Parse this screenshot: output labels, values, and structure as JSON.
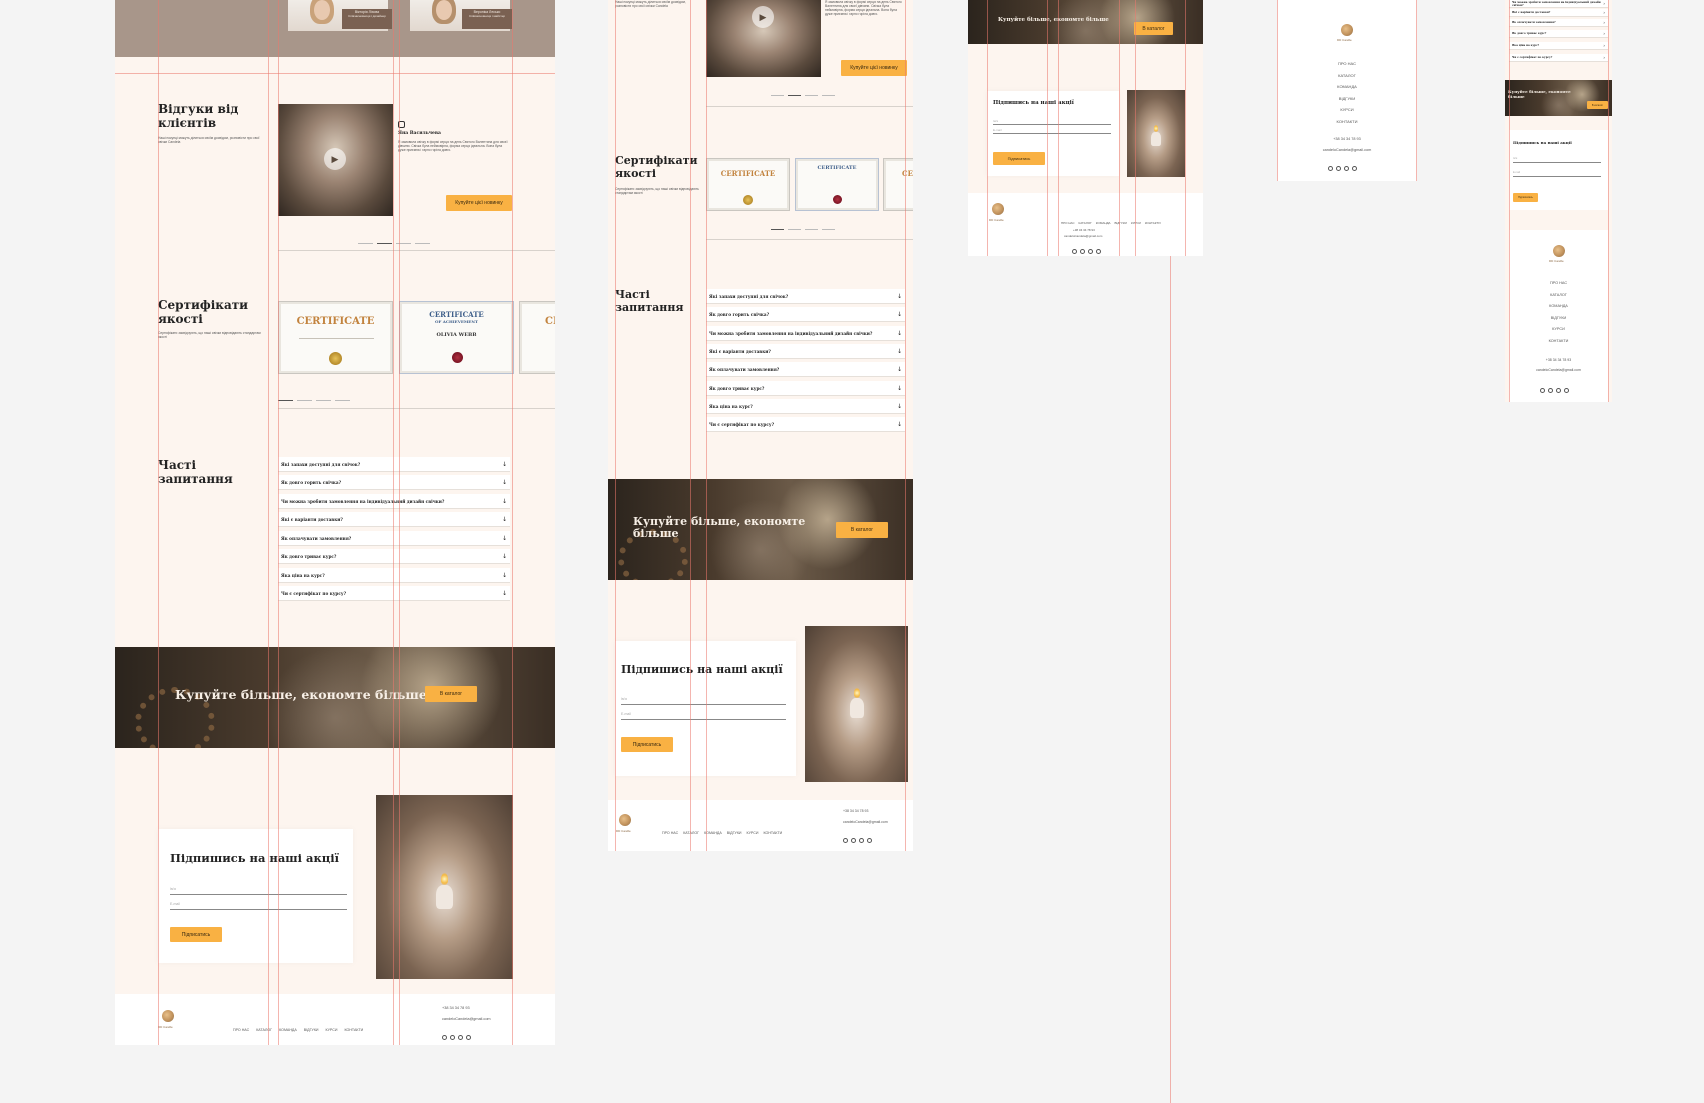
{
  "testimonials": {
    "title": "Відгуки від клієнтів",
    "desc": "Наші покупці можуть ділиться своїм досвідом, розповісти про свої свічки Candela",
    "reviewer_name": "Яна Васильчева",
    "review_text": "Я замовила свічку в формі серця на день Святого Валентина для своєї дівчини. Свічка була неймовірна, форма серця ідеальна. Вона була дуже приємна і гарно горіла довго.",
    "cta": "Купуйте цієї новинку",
    "team1_name": "Вікторія Ліхова",
    "team1_role": "Співзасновниця і дизайнер",
    "team2_name": "Вероніка Лесько",
    "team2_role": "Співзасновниця і майстер"
  },
  "certificates": {
    "title": "Сертифікати якості",
    "desc": "Сертифікати засвідчують, що наші свічки відповідають стандартам якості",
    "cert1_title": "CERTIFICATE",
    "cert2_title": "CERTIFICATE",
    "cert2_sub": "OF ACHIEVEMENT",
    "cert2_name": "OLIVIA WEBB",
    "cert3_title": "CE"
  },
  "faq": {
    "title": "Часті запитання",
    "items": [
      "Які запахи доступні для свічок?",
      "Як довго горить свічка?",
      "Чи можна зробити замовлення на індивідуальний дизайн свічки?",
      "Які є варіанти доставки?",
      "Як оплачувати замовлення?",
      "Як довго триває курс?",
      "Яка ціна на курс?",
      "Чи є сертифікат по курсу?"
    ]
  },
  "promo": {
    "title": "Купуйте більше, економте більше",
    "cta": "В каталог"
  },
  "subscribe": {
    "title": "Підпишись на наші акції",
    "name_placeholder": "Ім'я",
    "email_placeholder": "E-mail",
    "button": "Підписатись"
  },
  "footer": {
    "logo_text": "DD Candle",
    "nav": [
      "ПРО НАС",
      "КАТАЛОГ",
      "КОМАНДА",
      "ВІДГУКИ",
      "КУРСИ",
      "КОНТАКТИ"
    ],
    "phone": "+38 34 34 78 93",
    "email": "candeloCandela@gmail.com"
  },
  "colors": {
    "accent": "#f9b143",
    "background": "#fdf5ef",
    "guides": "#eb786e",
    "dark_banner": "#3a2e24"
  }
}
